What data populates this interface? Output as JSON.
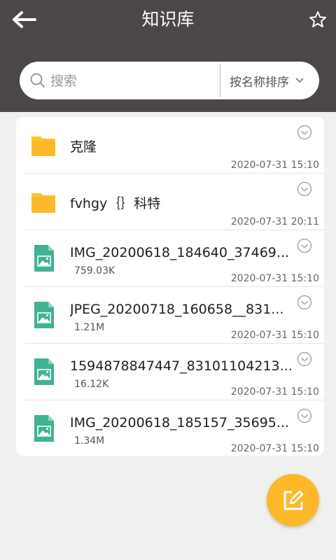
{
  "header": {
    "title": "知识库",
    "back_icon": "arrow-left-icon",
    "star_icon": "star-outline-icon"
  },
  "search": {
    "placeholder": "搜索",
    "value": "",
    "sort_label": "按名称排序"
  },
  "files": [
    {
      "type": "folder",
      "name": "克隆",
      "size": "",
      "date": "2020-07-31 15:10"
    },
    {
      "type": "folder",
      "name": "fvhgy｛｝科特",
      "size": "",
      "date": "2020-07-31 20:11"
    },
    {
      "type": "image",
      "name": "IMG_20200618_184640_37469...",
      "size": "759.03K",
      "date": "2020-07-31 15:10"
    },
    {
      "type": "image",
      "name": "JPEG_20200718_160658__831...",
      "size": "1.21M",
      "date": "2020-07-31 15:10"
    },
    {
      "type": "image",
      "name": "1594878847447_83101104213...",
      "size": "16.12K",
      "date": "2020-07-31 15:10"
    },
    {
      "type": "image",
      "name": "IMG_20200618_185157_35695...",
      "size": "1.34M",
      "date": "2020-07-31 15:10"
    }
  ],
  "fab_icon": "edit-icon",
  "colors": {
    "header_bg": "#4b4648",
    "folder": "#fcc22f",
    "image_file": "#3fb394",
    "fab": "#fdb82a"
  }
}
